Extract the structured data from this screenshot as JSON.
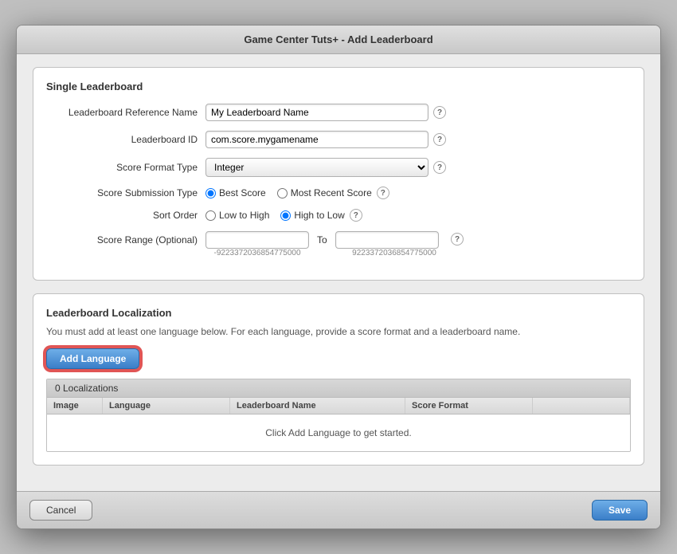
{
  "window": {
    "title": "Game Center Tuts+ - Add Leaderboard"
  },
  "single_section": {
    "title": "Single Leaderboard",
    "fields": {
      "reference_name_label": "Leaderboard Reference Name",
      "reference_name_value": "My Leaderboard Name",
      "leaderboard_id_label": "Leaderboard ID",
      "leaderboard_id_value": "com.score.mygamename",
      "score_format_label": "Score Format Type",
      "score_format_value": "Integer",
      "score_submission_label": "Score Submission Type",
      "best_score_label": "Best Score",
      "most_recent_label": "Most Recent Score",
      "sort_order_label": "Sort Order",
      "low_to_high_label": "Low to High",
      "high_to_low_label": "High to Low",
      "score_range_label": "Score Range (Optional)",
      "range_min_hint": "-9223372036854775000",
      "range_max_hint": "9223372036854775000",
      "to_label": "To"
    }
  },
  "localization_section": {
    "title": "Leaderboard Localization",
    "note": "You must add at least one language below. For each language, provide a score format and a leaderboard name.",
    "add_button_label": "Add Language",
    "localizations_count": "0 Localizations",
    "col_image": "Image",
    "col_language": "Language",
    "col_name": "Leaderboard Name",
    "col_format": "Score Format",
    "empty_message": "Click Add Language to get started."
  },
  "footer": {
    "cancel_label": "Cancel",
    "save_label": "Save"
  }
}
